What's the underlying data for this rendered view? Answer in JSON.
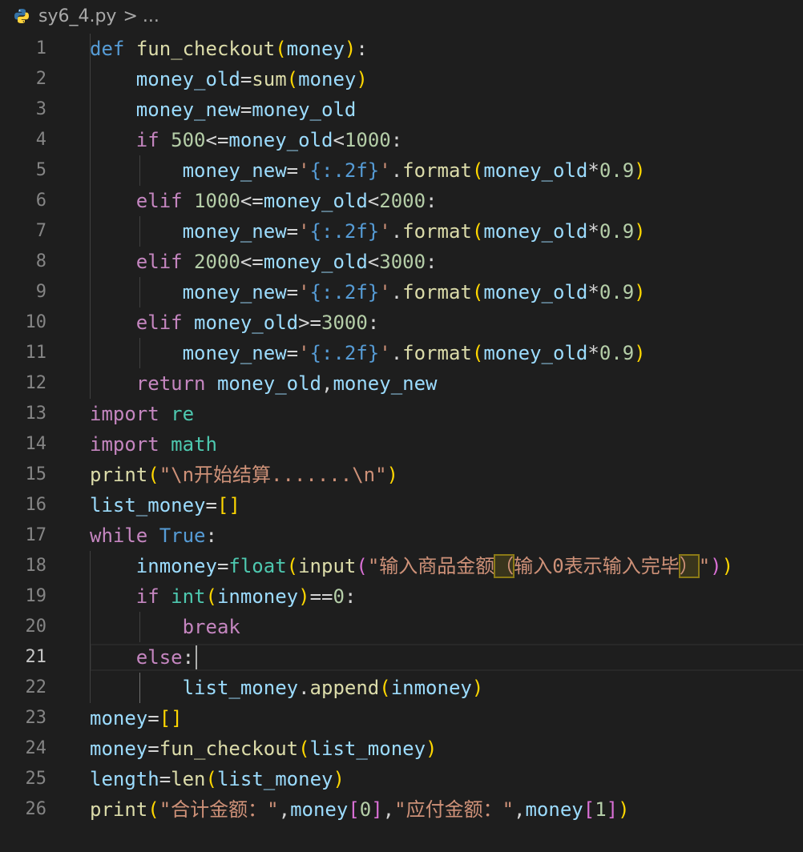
{
  "breadcrumb": {
    "file": "sy6_4.py",
    "separator": ">",
    "more": "...",
    "icon": "python-icon"
  },
  "editor": {
    "language": "python",
    "cursor_line": 21,
    "lines": [
      {
        "n": 1,
        "tokens": [
          [
            "kw2",
            "def"
          ],
          [
            "op",
            " "
          ],
          [
            "fn",
            "fun_checkout"
          ],
          [
            "b1",
            "("
          ],
          [
            "var",
            "money"
          ],
          [
            "b1",
            ")"
          ],
          [
            "op",
            ":"
          ]
        ]
      },
      {
        "n": 2,
        "tokens": [
          [
            "op",
            "    "
          ],
          [
            "var",
            "money_old"
          ],
          [
            "op",
            "="
          ],
          [
            "fn",
            "sum"
          ],
          [
            "b1",
            "("
          ],
          [
            "var",
            "money"
          ],
          [
            "b1",
            ")"
          ]
        ]
      },
      {
        "n": 3,
        "tokens": [
          [
            "op",
            "    "
          ],
          [
            "var",
            "money_new"
          ],
          [
            "op",
            "="
          ],
          [
            "var",
            "money_old"
          ]
        ]
      },
      {
        "n": 4,
        "tokens": [
          [
            "op",
            "    "
          ],
          [
            "kw",
            "if"
          ],
          [
            "op",
            " "
          ],
          [
            "num",
            "500"
          ],
          [
            "op",
            "<="
          ],
          [
            "var",
            "money_old"
          ],
          [
            "op",
            "<"
          ],
          [
            "num",
            "1000"
          ],
          [
            "op",
            ":"
          ]
        ]
      },
      {
        "n": 5,
        "tokens": [
          [
            "op",
            "        "
          ],
          [
            "var",
            "money_new"
          ],
          [
            "op",
            "="
          ],
          [
            "str",
            "'"
          ],
          [
            "fmt",
            "{:.2f}"
          ],
          [
            "str",
            "'"
          ],
          [
            "op",
            "."
          ],
          [
            "fn",
            "format"
          ],
          [
            "b1",
            "("
          ],
          [
            "var",
            "money_old"
          ],
          [
            "op",
            "*"
          ],
          [
            "num",
            "0.9"
          ],
          [
            "b1",
            ")"
          ]
        ]
      },
      {
        "n": 6,
        "tokens": [
          [
            "op",
            "    "
          ],
          [
            "kw",
            "elif"
          ],
          [
            "op",
            " "
          ],
          [
            "num",
            "1000"
          ],
          [
            "op",
            "<="
          ],
          [
            "var",
            "money_old"
          ],
          [
            "op",
            "<"
          ],
          [
            "num",
            "2000"
          ],
          [
            "op",
            ":"
          ]
        ]
      },
      {
        "n": 7,
        "tokens": [
          [
            "op",
            "        "
          ],
          [
            "var",
            "money_new"
          ],
          [
            "op",
            "="
          ],
          [
            "str",
            "'"
          ],
          [
            "fmt",
            "{:.2f}"
          ],
          [
            "str",
            "'"
          ],
          [
            "op",
            "."
          ],
          [
            "fn",
            "format"
          ],
          [
            "b1",
            "("
          ],
          [
            "var",
            "money_old"
          ],
          [
            "op",
            "*"
          ],
          [
            "num",
            "0.9"
          ],
          [
            "b1",
            ")"
          ]
        ]
      },
      {
        "n": 8,
        "tokens": [
          [
            "op",
            "    "
          ],
          [
            "kw",
            "elif"
          ],
          [
            "op",
            " "
          ],
          [
            "num",
            "2000"
          ],
          [
            "op",
            "<="
          ],
          [
            "var",
            "money_old"
          ],
          [
            "op",
            "<"
          ],
          [
            "num",
            "3000"
          ],
          [
            "op",
            ":"
          ]
        ]
      },
      {
        "n": 9,
        "tokens": [
          [
            "op",
            "        "
          ],
          [
            "var",
            "money_new"
          ],
          [
            "op",
            "="
          ],
          [
            "str",
            "'"
          ],
          [
            "fmt",
            "{:.2f}"
          ],
          [
            "str",
            "'"
          ],
          [
            "op",
            "."
          ],
          [
            "fn",
            "format"
          ],
          [
            "b1",
            "("
          ],
          [
            "var",
            "money_old"
          ],
          [
            "op",
            "*"
          ],
          [
            "num",
            "0.9"
          ],
          [
            "b1",
            ")"
          ]
        ]
      },
      {
        "n": 10,
        "tokens": [
          [
            "op",
            "    "
          ],
          [
            "kw",
            "elif"
          ],
          [
            "op",
            " "
          ],
          [
            "var",
            "money_old"
          ],
          [
            "op",
            ">="
          ],
          [
            "num",
            "3000"
          ],
          [
            "op",
            ":"
          ]
        ]
      },
      {
        "n": 11,
        "tokens": [
          [
            "op",
            "        "
          ],
          [
            "var",
            "money_new"
          ],
          [
            "op",
            "="
          ],
          [
            "str",
            "'"
          ],
          [
            "fmt",
            "{:.2f}"
          ],
          [
            "str",
            "'"
          ],
          [
            "op",
            "."
          ],
          [
            "fn",
            "format"
          ],
          [
            "b1",
            "("
          ],
          [
            "var",
            "money_old"
          ],
          [
            "op",
            "*"
          ],
          [
            "num",
            "0.9"
          ],
          [
            "b1",
            ")"
          ]
        ]
      },
      {
        "n": 12,
        "tokens": [
          [
            "op",
            "    "
          ],
          [
            "kw",
            "return"
          ],
          [
            "op",
            " "
          ],
          [
            "var",
            "money_old"
          ],
          [
            "op",
            ","
          ],
          [
            "var",
            "money_new"
          ]
        ]
      },
      {
        "n": 13,
        "tokens": [
          [
            "kw",
            "import"
          ],
          [
            "op",
            " "
          ],
          [
            "mod",
            "re"
          ]
        ]
      },
      {
        "n": 14,
        "tokens": [
          [
            "kw",
            "import"
          ],
          [
            "op",
            " "
          ],
          [
            "mod",
            "math"
          ]
        ]
      },
      {
        "n": 15,
        "tokens": [
          [
            "fn",
            "print"
          ],
          [
            "b1",
            "("
          ],
          [
            "str",
            "\"\\n开始结算.......\\n\""
          ],
          [
            "b1",
            ")"
          ]
        ]
      },
      {
        "n": 16,
        "tokens": [
          [
            "var",
            "list_money"
          ],
          [
            "op",
            "="
          ],
          [
            "b1",
            "[]"
          ]
        ]
      },
      {
        "n": 17,
        "tokens": [
          [
            "kw",
            "while"
          ],
          [
            "op",
            " "
          ],
          [
            "kw2",
            "True"
          ],
          [
            "op",
            ":"
          ]
        ]
      },
      {
        "n": 18,
        "tokens": [
          [
            "op",
            "    "
          ],
          [
            "var",
            "inmoney"
          ],
          [
            "op",
            "="
          ],
          [
            "cls",
            "float"
          ],
          [
            "b1",
            "("
          ],
          [
            "fn",
            "input"
          ],
          [
            "b2",
            "("
          ],
          [
            "str",
            "\"输入商品金额"
          ],
          [
            "str hl",
            "（"
          ],
          [
            "str",
            "输入0表示输入完毕"
          ],
          [
            "str hl",
            "）"
          ],
          [
            "str",
            "\""
          ],
          [
            "b2",
            ")"
          ],
          [
            "b1",
            ")"
          ]
        ]
      },
      {
        "n": 19,
        "tokens": [
          [
            "op",
            "    "
          ],
          [
            "kw",
            "if"
          ],
          [
            "op",
            " "
          ],
          [
            "cls",
            "int"
          ],
          [
            "b1",
            "("
          ],
          [
            "var",
            "inmoney"
          ],
          [
            "b1",
            ")"
          ],
          [
            "op",
            "=="
          ],
          [
            "num",
            "0"
          ],
          [
            "op",
            ":"
          ]
        ]
      },
      {
        "n": 20,
        "tokens": [
          [
            "op",
            "        "
          ],
          [
            "kw",
            "break"
          ]
        ]
      },
      {
        "n": 21,
        "tokens": [
          [
            "op",
            "    "
          ],
          [
            "kw",
            "else"
          ],
          [
            "op",
            ":"
          ]
        ]
      },
      {
        "n": 22,
        "tokens": [
          [
            "op",
            "        "
          ],
          [
            "var",
            "list_money"
          ],
          [
            "op",
            "."
          ],
          [
            "fn",
            "append"
          ],
          [
            "b1",
            "("
          ],
          [
            "var",
            "inmoney"
          ],
          [
            "b1",
            ")"
          ]
        ]
      },
      {
        "n": 23,
        "tokens": [
          [
            "var",
            "money"
          ],
          [
            "op",
            "="
          ],
          [
            "b1",
            "[]"
          ]
        ]
      },
      {
        "n": 24,
        "tokens": [
          [
            "var",
            "money"
          ],
          [
            "op",
            "="
          ],
          [
            "fn",
            "fun_checkout"
          ],
          [
            "b1",
            "("
          ],
          [
            "var",
            "list_money"
          ],
          [
            "b1",
            ")"
          ]
        ]
      },
      {
        "n": 25,
        "tokens": [
          [
            "var",
            "length"
          ],
          [
            "op",
            "="
          ],
          [
            "fn",
            "len"
          ],
          [
            "b1",
            "("
          ],
          [
            "var",
            "list_money"
          ],
          [
            "b1",
            ")"
          ]
        ]
      },
      {
        "n": 26,
        "tokens": [
          [
            "fn",
            "print"
          ],
          [
            "b1",
            "("
          ],
          [
            "str",
            "\"合计金额：\""
          ],
          [
            "op",
            ","
          ],
          [
            "var",
            "money"
          ],
          [
            "b2",
            "["
          ],
          [
            "num",
            "0"
          ],
          [
            "b2",
            "]"
          ],
          [
            "op",
            ","
          ],
          [
            "str",
            "\"应付金额：\""
          ],
          [
            "op",
            ","
          ],
          [
            "var",
            "money"
          ],
          [
            "b2",
            "["
          ],
          [
            "num",
            "1"
          ],
          [
            "b2",
            "]"
          ],
          [
            "b1",
            ")"
          ]
        ]
      }
    ]
  }
}
